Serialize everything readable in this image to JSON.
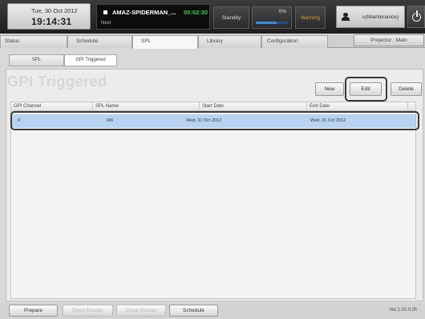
{
  "header": {
    "date": "Tue, 30 Oct 2012",
    "time": "19:14:31",
    "now_playing": {
      "title": "AMAZ-SPIDERMAN_...",
      "elapsed": "00:02:30",
      "next_label": "Next"
    },
    "standby_label": "Standby",
    "progress_label": "0%",
    "progress_fraction": 0.66,
    "warning_label": "Warning",
    "user_label": "u(Maintenance)",
    "icons": {
      "user": "user-icon",
      "power": "power-icon"
    },
    "colors": {
      "elapsed": "#3bd14a",
      "warning": "#e2a32b",
      "progress": "#3b8ae0"
    }
  },
  "tabs": {
    "status": "Status",
    "schedule": "Schedule",
    "spl": "SPL",
    "library": "Library",
    "configuration": "Configuration",
    "active": "SPL"
  },
  "projector_label": "Projector : Main",
  "subtabs": {
    "spl": "SPL",
    "gpi": "GPI Triggered",
    "active": "GPI Triggered"
  },
  "page_title": "GPI Triggered",
  "actions": {
    "new": "New",
    "edit": "Edit",
    "delete": "Delete"
  },
  "table": {
    "columns": [
      "GPI Channel",
      "SPL Name",
      "Start Date",
      "End Date"
    ],
    "rows": [
      {
        "channel": "0",
        "spl_name": "W6",
        "start": "Wed, 31 Oct 2012",
        "end": "Wed, 31 Oct 2012",
        "selected": true
      }
    ]
  },
  "footer": {
    "prepare": "Prepare",
    "open_douser": "Open Douser",
    "close_douser": "Close Douser",
    "schedule": "Schedule",
    "version": "Ver.1.00.0.IR"
  }
}
